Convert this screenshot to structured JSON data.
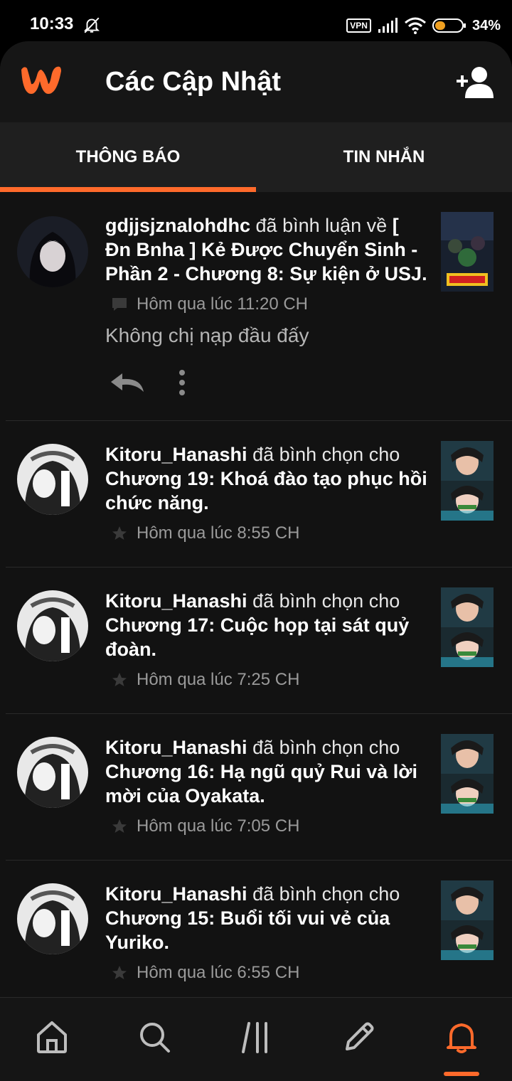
{
  "status_bar": {
    "time": "10:33",
    "vpn": "VPN",
    "battery": "34%"
  },
  "header": {
    "title": "Các Cập Nhật"
  },
  "tabs": [
    {
      "label": "THÔNG BÁO",
      "active": true
    },
    {
      "label": "TIN NHẮN",
      "active": false
    }
  ],
  "notifications": [
    {
      "user": "gdjjsjznalohdhc",
      "verb": "đã bình luận về",
      "story": "[ Đn Bnha ] Kẻ Được Chuyển Sinh - Phần 2 - Chương 8: Sự kiện ở USJ.",
      "time": "Hôm qua lúc 11:20 CH",
      "type": "comment",
      "comment": "Không chị nạp đầu đấy"
    },
    {
      "user": "Kitoru_Hanashi",
      "verb": "đã bình chọn cho",
      "story": "Chương 19: Khoá đào tạo phục hồi chức năng.",
      "time": "Hôm qua lúc 8:55 CH",
      "type": "vote"
    },
    {
      "user": "Kitoru_Hanashi",
      "verb": "đã bình chọn cho",
      "story": "Chương 17: Cuộc họp tại sát quỷ đoàn.",
      "time": "Hôm qua lúc 7:25 CH",
      "type": "vote"
    },
    {
      "user": "Kitoru_Hanashi",
      "verb": "đã bình chọn cho",
      "story": "Chương 16: Hạ ngũ quỷ Rui và lời mời của Oyakata.",
      "time": "Hôm qua lúc 7:05 CH",
      "type": "vote"
    },
    {
      "user": "Kitoru_Hanashi",
      "verb": "đã bình chọn cho",
      "story": "Chương 15: Buổi tối vui vẻ của Yuriko.",
      "time": "Hôm qua lúc 6:55 CH",
      "type": "vote"
    }
  ],
  "bottom_nav": [
    {
      "icon": "home-icon",
      "active": false
    },
    {
      "icon": "search-icon",
      "active": false
    },
    {
      "icon": "library-icon",
      "active": false
    },
    {
      "icon": "write-icon",
      "active": false
    },
    {
      "icon": "notifications-bell-icon",
      "active": true
    }
  ],
  "colors": {
    "accent": "#ff6a2b",
    "background": "#121212"
  }
}
